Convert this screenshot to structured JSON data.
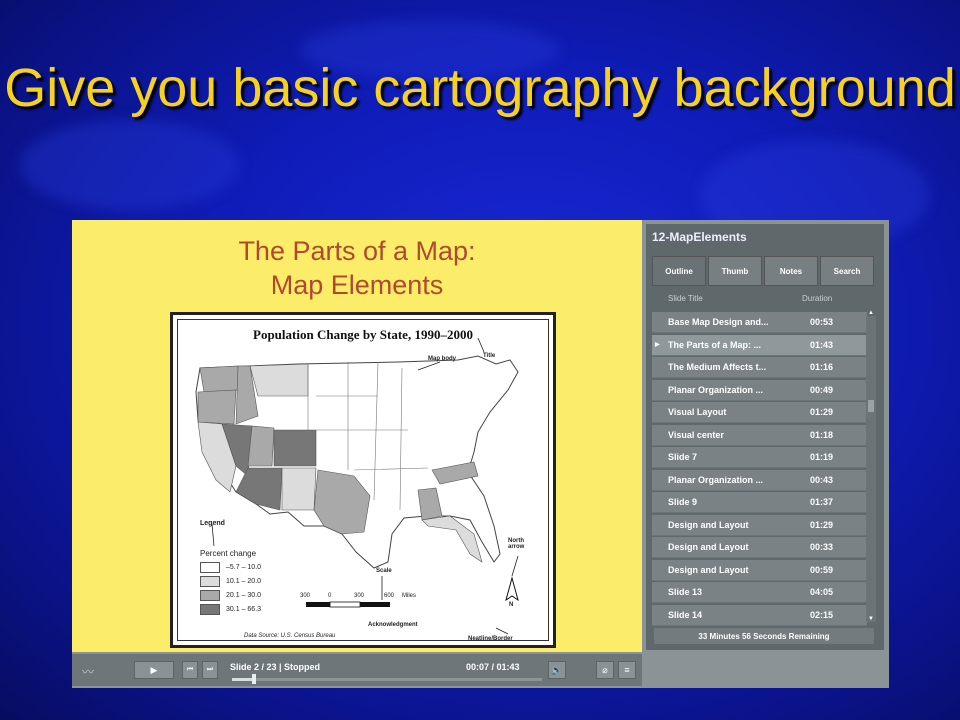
{
  "slide": {
    "title": "Give you basic cartography background"
  },
  "player": {
    "stage": {
      "title_line1": "The Parts of a Map:",
      "title_line2": "Map Elements",
      "map": {
        "heading": "Population Change by State, 1990–2000",
        "callouts": {
          "title": "Title",
          "map_body": "Map body",
          "legend": "Legend",
          "scale": "Scale",
          "north_arrow": "North arrow",
          "acknowledgment": "Acknowledgment",
          "neatline": "Neatline/Border"
        },
        "legend_title": "Percent change",
        "legend_items": [
          "–5.7 – 10.0",
          "10.1 – 20.0",
          "20.1 – 30.0",
          "30.1 – 66.3"
        ],
        "legend_colors": [
          "#ffffff",
          "#dcdcdc",
          "#a9a9a9",
          "#777777"
        ],
        "scale_ticks": [
          "300",
          "0",
          "300",
          "600",
          "Miles"
        ],
        "north_label": "N",
        "source": "Data Source: U.S. Census Bureau"
      }
    },
    "sidebar": {
      "course_title": "12-MapElements",
      "tabs": [
        "Outline",
        "Thumb",
        "Notes",
        "Search"
      ],
      "columns": {
        "title": "Slide Title",
        "duration": "Duration"
      },
      "rows": [
        {
          "title": "Base Map Design and...",
          "duration": "00:53"
        },
        {
          "title": "The Parts of a Map: ...",
          "duration": "01:43"
        },
        {
          "title": "The Medium Affects t...",
          "duration": "01:16"
        },
        {
          "title": "Planar Organization ...",
          "duration": "00:49"
        },
        {
          "title": "Visual Layout",
          "duration": "01:29"
        },
        {
          "title": "Visual center",
          "duration": "01:18"
        },
        {
          "title": "Slide 7",
          "duration": "01:19"
        },
        {
          "title": "Planar Organization ...",
          "duration": "00:43"
        },
        {
          "title": "Slide 9",
          "duration": "01:37"
        },
        {
          "title": "Design and Layout",
          "duration": "01:29"
        },
        {
          "title": "Design and Layout",
          "duration": "00:33"
        },
        {
          "title": "Design and Layout",
          "duration": "00:59"
        },
        {
          "title": "Slide 13",
          "duration": "04:05"
        },
        {
          "title": "Slide 14",
          "duration": "02:15"
        }
      ],
      "selected_index": 1,
      "remaining": "33 Minutes 56 Seconds Remaining"
    },
    "controls": {
      "status": "Slide 2 / 23 | Stopped",
      "time": "00:07 / 01:43",
      "progress": 0.07
    }
  }
}
